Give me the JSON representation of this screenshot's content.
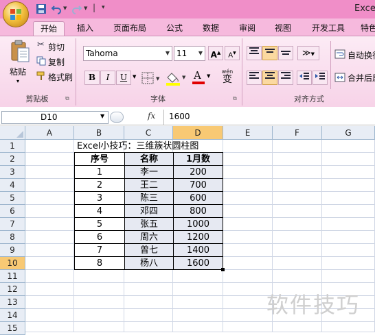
{
  "app": {
    "title": "Exce"
  },
  "colors": {
    "title_bar": "#f08ec8",
    "ribbon": "#f7d3e8",
    "selected_header": "#f8c974"
  },
  "tabs": [
    "开始",
    "插入",
    "页面布局",
    "公式",
    "数据",
    "审阅",
    "视图",
    "开发工具",
    "特色"
  ],
  "ribbon": {
    "clipboard": {
      "paste": "粘贴",
      "cut": "剪切",
      "copy": "复制",
      "format_painter": "格式刷",
      "label": "剪贴板"
    },
    "font": {
      "name": "Tahoma",
      "size": "11",
      "grow": "A",
      "shrink": "A",
      "bold": "B",
      "italic": "I",
      "underline": "U",
      "font_color": "A",
      "phonetic": "wén",
      "phonetic_char": "变",
      "label": "字体"
    },
    "alignment": {
      "wrap": "自动换行",
      "merge": "合并后居",
      "label": "对齐方式"
    }
  },
  "formula_bar": {
    "name_box": "D10",
    "fx": "fx",
    "value": "1600"
  },
  "columns": [
    "A",
    "B",
    "C",
    "D",
    "E",
    "F",
    "G"
  ],
  "rows": [
    "1",
    "2",
    "3",
    "4",
    "5",
    "6",
    "7",
    "8",
    "9",
    "10",
    "11",
    "12",
    "13",
    "14",
    "15"
  ],
  "sheet": {
    "title": "Excel小技巧：三维簇状圆柱图",
    "headers": [
      "序号",
      "名称",
      "1月数"
    ],
    "data": [
      [
        "1",
        "李一",
        "200"
      ],
      [
        "2",
        "王二",
        "700"
      ],
      [
        "3",
        "陈三",
        "600"
      ],
      [
        "4",
        "邓四",
        "800"
      ],
      [
        "5",
        "张五",
        "1000"
      ],
      [
        "6",
        "周六",
        "1200"
      ],
      [
        "7",
        "曾七",
        "1400"
      ],
      [
        "8",
        "杨八",
        "1600"
      ]
    ]
  },
  "watermark": "软件技巧"
}
